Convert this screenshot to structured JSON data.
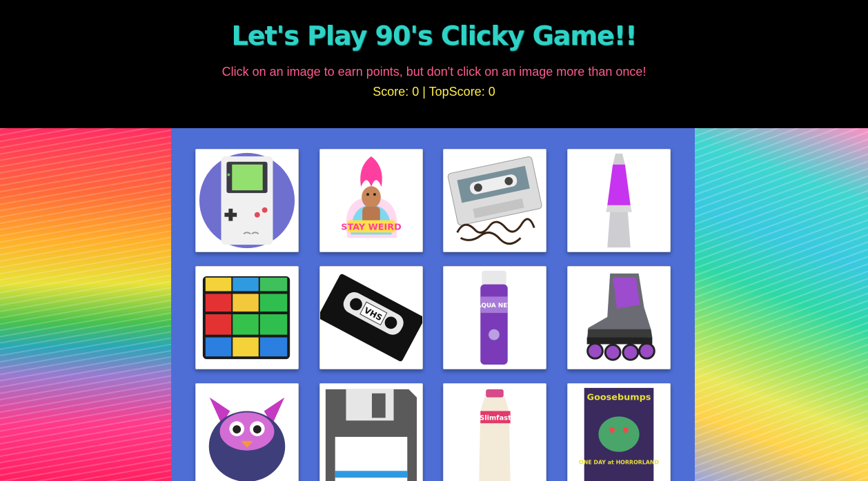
{
  "header": {
    "title": "Let's Play 90's Clicky Game!!",
    "subtitle": "Click on an image to earn points, but don't click on an image more than once!",
    "score_text": "Score: 0 | TopScore: 0",
    "score": 0,
    "top_score": 0
  },
  "colors": {
    "header_bg": "#000000",
    "title": "#2ed3c6",
    "subtitle": "#ff5b8e",
    "score": "#ffee4a",
    "panel": "#4e6ed6"
  },
  "cards": [
    {
      "name": "gameboy-card",
      "image": "game-boy"
    },
    {
      "name": "troll-doll-card",
      "image": "troll-doll",
      "text": "STAY WEIRD"
    },
    {
      "name": "cassette-tape-card",
      "image": "cassette-tape"
    },
    {
      "name": "lava-lamp-card",
      "image": "lava-lamp"
    },
    {
      "name": "rubiks-cube-card",
      "image": "rubiks-cube"
    },
    {
      "name": "vhs-tape-card",
      "image": "vhs-tape",
      "text": "VHS"
    },
    {
      "name": "aqua-net-card",
      "image": "aqua-net-hairspray",
      "text": "AQUA NET"
    },
    {
      "name": "rollerblade-card",
      "image": "rollerblade"
    },
    {
      "name": "furby-card",
      "image": "furby"
    },
    {
      "name": "floppy-disk-card",
      "image": "floppy-disk"
    },
    {
      "name": "slimfast-card",
      "image": "slimfast-bottle",
      "text": "Slimfast"
    },
    {
      "name": "goosebumps-card",
      "image": "goosebumps-book",
      "text": "Goosebumps",
      "subtext": "ONE DAY at HORRORLAND"
    }
  ]
}
